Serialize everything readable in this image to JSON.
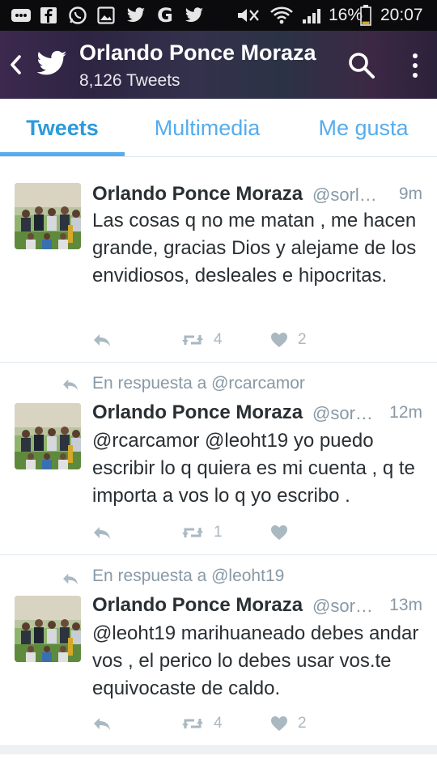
{
  "status_bar": {
    "icons": [
      "messages-icon",
      "facebook-icon",
      "whatsapp-icon",
      "gallery-icon",
      "twitter-icon",
      "google-icon",
      "twitter-icon",
      "mute-icon",
      "wifi-icon",
      "signal-icon",
      "battery-icon"
    ],
    "battery_percent": "16%",
    "battery_level": 0.16,
    "time": "20:07"
  },
  "header": {
    "name": "Orlando Ponce Moraza",
    "tweet_count": "8,126 Tweets"
  },
  "tabs": [
    {
      "label": "Tweets",
      "active": true
    },
    {
      "label": "Multimedia",
      "active": false
    },
    {
      "label": "Me gusta",
      "active": false
    }
  ],
  "tweets": [
    {
      "reply_to": "",
      "author": "Orlando Ponce Moraza",
      "handle": "@sorla...",
      "time": "9m",
      "text": "Las cosas q no me matan , me hacen grande, gracias Dios y alejame de los envidiosos, desleales e hipocritas.",
      "retweets": "4",
      "likes": "2"
    },
    {
      "reply_to": "En respuesta a @rcarcamor",
      "author": "Orlando Ponce Moraza",
      "handle": "@sorl...",
      "time": "12m",
      "text": "@rcarcamor @leoht19  yo puedo escribir lo q quiera es mi cuenta , q te importa a vos lo q yo escribo .",
      "retweets": "1",
      "likes": ""
    },
    {
      "reply_to": "En respuesta a @leoht19",
      "author": "Orlando Ponce Moraza",
      "handle": "@sorl...",
      "time": "13m",
      "text": "@leoht19  marihuaneado debes andar vos , el perico lo debes usar vos.te equivocaste de caldo.",
      "retweets": "4",
      "likes": "2"
    }
  ],
  "colors": {
    "accent": "#55acee",
    "muted": "#8899a6",
    "action_icon": "#aab8c2"
  }
}
